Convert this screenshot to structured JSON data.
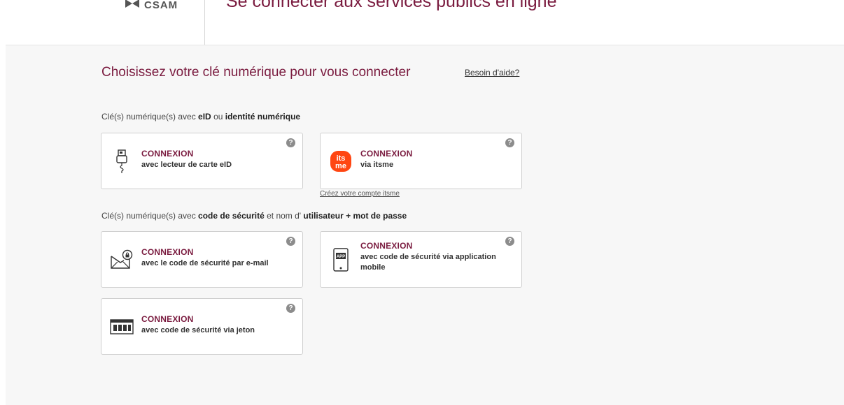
{
  "header": {
    "logo_text": "CSAM",
    "title": "Se connecter aux services publics en ligne"
  },
  "main": {
    "page_title": "Choisissez votre clé numérique pour vous connecter",
    "help_link": "Besoin d'aide?",
    "section1": {
      "prefix": "Clé(s) numérique(s) avec ",
      "bold1": "eID",
      "middle": " ou ",
      "bold2": "identité numérique"
    },
    "section2": {
      "prefix": "Clé(s) numérique(s) avec ",
      "bold1": "code de sécurité",
      "middle": " et nom d' ",
      "bold2": "utilisateur + mot de passe"
    },
    "help_glyph": "?",
    "cards": [
      {
        "title": "CONNEXION",
        "subtitle": "avec lecteur de carte eID",
        "icon": "card-reader-icon"
      },
      {
        "title": "CONNEXION",
        "subtitle": "via itsme",
        "icon": "itsme-logo-icon",
        "icon_text_top": "its",
        "icon_text_bottom": "me"
      },
      {
        "title": "CONNEXION",
        "subtitle": "avec le code de sécurité par e-mail",
        "icon": "email-lock-icon"
      },
      {
        "title": "CONNEXION",
        "subtitle": "avec code de sécurité via application mobile",
        "icon": "mobile-app-icon",
        "icon_text": "APP"
      },
      {
        "title": "CONNEXION",
        "subtitle": "avec code de sécurité via jeton",
        "icon": "token-icon"
      }
    ],
    "itsme_link": "Créez votre compte itsme"
  },
  "colors": {
    "brand": "#7a1b3f",
    "itsme": "#ff4612",
    "background": "#f7f7f7"
  }
}
